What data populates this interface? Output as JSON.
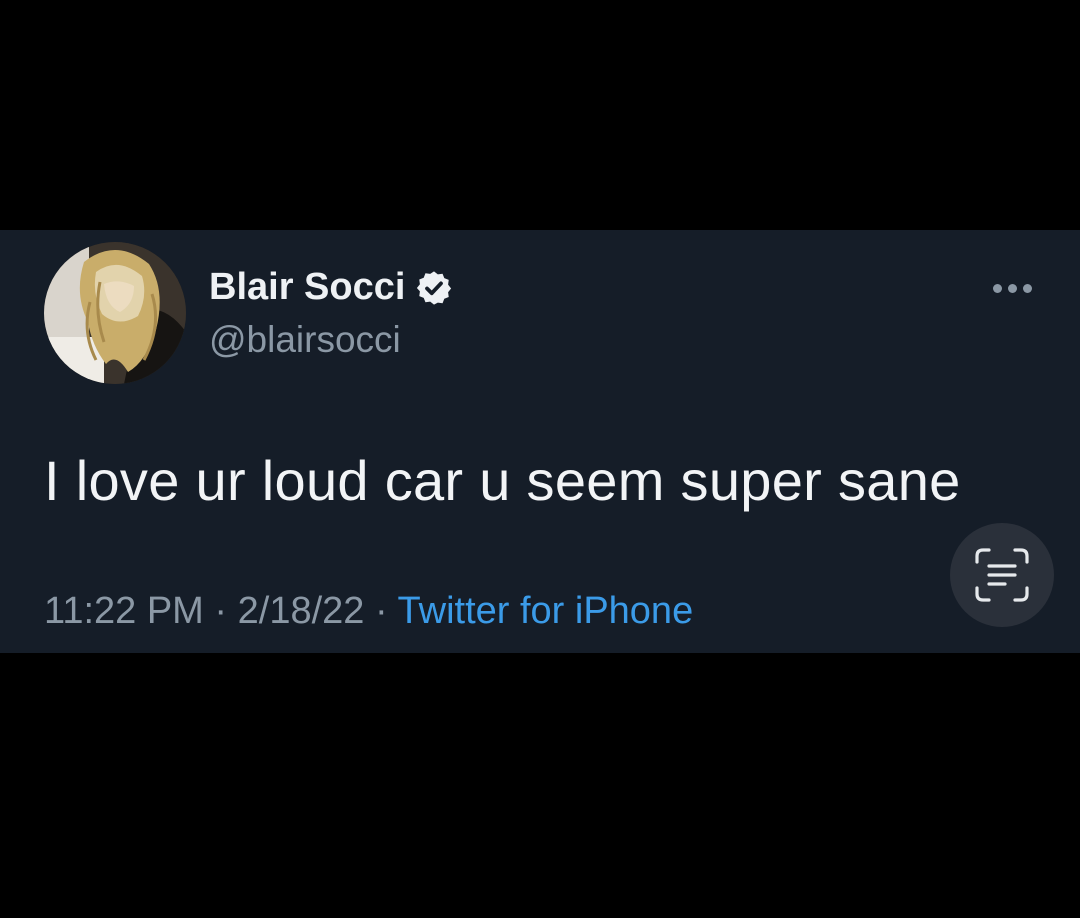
{
  "tweet": {
    "author": {
      "display_name": "Blair Socci",
      "handle": "@blairsocci",
      "verified": true
    },
    "text": "I love ur loud car u seem super sane",
    "time": "11:22 PM",
    "separator": "·",
    "date": "2/18/22",
    "source": "Twitter for iPhone"
  },
  "icons": {
    "more": "more-horizontal-icon",
    "verified": "verified-badge-icon",
    "scan": "live-text-scan-icon"
  },
  "colors": {
    "background": "#000000",
    "card": "#151d28",
    "primary_text": "#eef1f4",
    "secondary_text": "#8b98a5",
    "link": "#3b9be8"
  }
}
